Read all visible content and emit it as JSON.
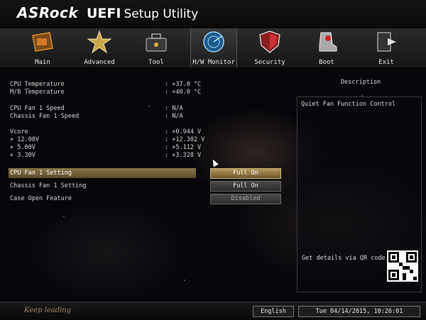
{
  "header": {
    "brand": "ASRock",
    "title_bold": "UEFI",
    "title_rest": "Setup Utility"
  },
  "nav": {
    "tabs": [
      {
        "label": "Main",
        "icon": "main-icon"
      },
      {
        "label": "Advanced",
        "icon": "star-icon"
      },
      {
        "label": "Tool",
        "icon": "toolbox-icon"
      },
      {
        "label": "H/W Monitor",
        "icon": "radar-icon",
        "active": true
      },
      {
        "label": "Security",
        "icon": "shield-icon"
      },
      {
        "label": "Boot",
        "icon": "boot-icon"
      },
      {
        "label": "Exit",
        "icon": "exit-icon"
      }
    ]
  },
  "monitor": {
    "cpu_temp": {
      "label": "CPU Temperature",
      "value": ": +37.0 °C"
    },
    "mb_temp": {
      "label": "M/B Temperature",
      "value": ": +40.0 °C"
    },
    "cpu_fan": {
      "label": "CPU Fan 1 Speed",
      "value": ": N/A"
    },
    "chassis_fan": {
      "label": "Chassis Fan 1 Speed",
      "value": ": N/A"
    },
    "vcore": {
      "label": "Vcore",
      "value": ": +0.944 V"
    },
    "v12": {
      "label": "+ 12.00V",
      "value": ": +12.302 V"
    },
    "v5": {
      "label": "+ 5.00V",
      "value": ": +5.112 V"
    },
    "v33": {
      "label": "+ 3.30V",
      "value": ": +3.328 V"
    }
  },
  "settings": {
    "cpu_fan_setting": {
      "label": "CPU Fan 1 Setting",
      "value": "Full On"
    },
    "chassis_fan_setting": {
      "label": "Chassis Fan 1 Setting",
      "value": "Full On"
    },
    "case_open": {
      "label": "Case Open Feature",
      "value": "Disabled"
    }
  },
  "description": {
    "heading": "Description",
    "text": "Quiet Fan Function Control",
    "qr_label": "Get details via QR code"
  },
  "footer": {
    "slogan": "Keep leading",
    "language": "English",
    "datetime": "Tue 04/14/2015, 10:26:01"
  },
  "colors": {
    "accent": "#b49a5a",
    "selected_row": "#8a7748"
  }
}
